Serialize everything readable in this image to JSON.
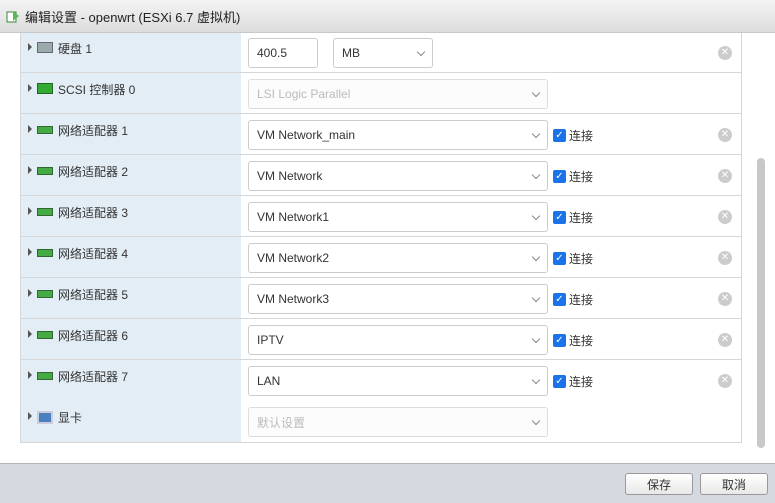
{
  "title": "编辑设置 - openwrt (ESXi 6.7 虚拟机)",
  "disk": {
    "label": "硬盘 1",
    "size": "400.5",
    "unit": "MB"
  },
  "scsi": {
    "label": "SCSI 控制器 0",
    "value": "LSI Logic Parallel"
  },
  "adapters": [
    {
      "label": "网络适配器 1",
      "network": "VM Network_main",
      "connect": "连接"
    },
    {
      "label": "网络适配器 2",
      "network": "VM Network",
      "connect": "连接"
    },
    {
      "label": "网络适配器 3",
      "network": "VM Network1",
      "connect": "连接"
    },
    {
      "label": "网络适配器 4",
      "network": "VM Network2",
      "connect": "连接"
    },
    {
      "label": "网络适配器 5",
      "network": "VM Network3",
      "connect": "连接"
    },
    {
      "label": "网络适配器 6",
      "network": "IPTV",
      "connect": "连接"
    },
    {
      "label": "网络适配器 7",
      "network": "LAN",
      "connect": "连接"
    }
  ],
  "video": {
    "label": "显卡",
    "value": "默认设置"
  },
  "footer": {
    "save": "保存",
    "cancel": "取消"
  }
}
